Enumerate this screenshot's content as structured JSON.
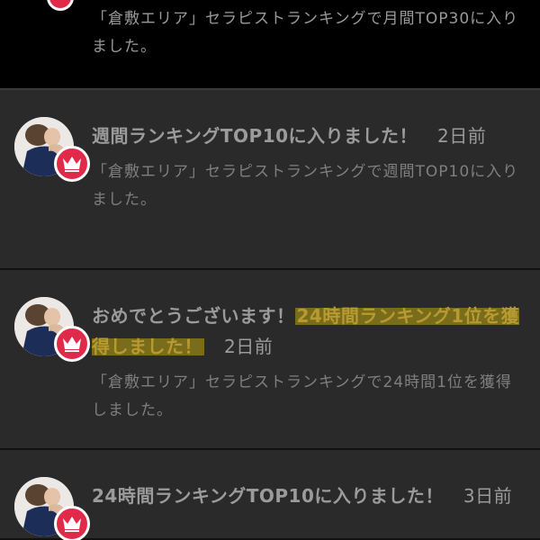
{
  "notifications": [
    {
      "body": "「倉敷エリア」セラピストランキングで月間TOP30に入りました。"
    },
    {
      "title": "週間ランキングTOP10に入りました！",
      "date": "2日前",
      "body": "「倉敷エリア」セラピストランキングで週間TOP10に入りました。"
    },
    {
      "title_prefix": "おめでとうございます！",
      "title_highlight": "24時間ランキング1位を獲得しました！",
      "date": "2日前",
      "body": "「倉敷エリア」セラピストランキングで24時間1位を獲得しました。"
    },
    {
      "title": "24時間ランキングTOP10に入りました！",
      "date": "3日前"
    }
  ],
  "colors": {
    "badge": "#e02a4a",
    "highlight": "#7d7019",
    "card_bg": "#2a2a2a"
  },
  "icons": {
    "badge": "crown-icon",
    "avatar": "therapist-avatar"
  }
}
